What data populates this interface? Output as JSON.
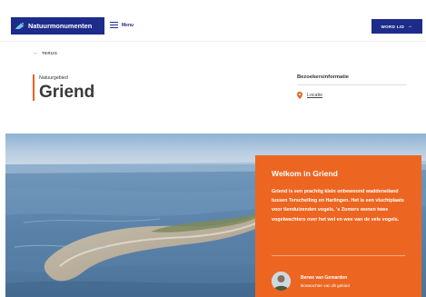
{
  "header": {
    "logo_text": "Natuurmonumenten",
    "menu_label": "Menu",
    "join_label": "WORD LID",
    "join_arrow": "→"
  },
  "nav": {
    "back_label": "TERUG",
    "back_arrow": "←"
  },
  "page": {
    "eyebrow": "Natuurgebied",
    "title": "Griend"
  },
  "visitor_info": {
    "heading": "Bezoekersinformatie",
    "location_link": "Locatie"
  },
  "card": {
    "title": "Welkom in Griend",
    "body": "Griend is een prachtig klein onbewoond waddeneiland tussen Terschelling en Harlingen. Het is een vluchtplaats voor tienduizenden vogels. 's Zomers wonen twee vogelwachters over het wel en wee van de vele vogels.",
    "author_name": "Berwe van Gemarden",
    "author_role": "Boswachter van dit gebied"
  },
  "colors": {
    "brand_blue": "#1d2b8a",
    "accent_orange": "#e8641b",
    "card_orange": "#ec6621"
  }
}
